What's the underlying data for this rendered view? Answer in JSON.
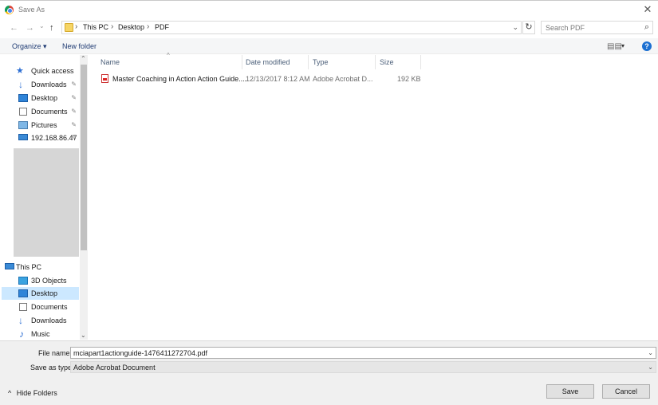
{
  "window": {
    "title": "Save As",
    "close_glyph": "✕"
  },
  "nav": {
    "back_glyph": "←",
    "forward_glyph": "→",
    "recent_glyph": "⌄",
    "up_glyph": "↑"
  },
  "address": {
    "crumbs": [
      "This PC",
      "Desktop",
      "PDF"
    ],
    "separator": "›",
    "dropdown_glyph": "⌄",
    "refresh_glyph": "↻"
  },
  "search": {
    "placeholder": "Search PDF",
    "icon_glyph": "⌕"
  },
  "toolbar": {
    "organize_label": "Organize ▾",
    "new_folder_label": "New folder",
    "view_glyph": "▤▤",
    "view_drop_glyph": "▾",
    "help_glyph": "?"
  },
  "sidebar": {
    "quick_access": [
      {
        "label": "Quick access",
        "icon": "star-icon",
        "pinned": false
      },
      {
        "label": "Downloads",
        "icon": "download-arrow-icon",
        "pinned": true
      },
      {
        "label": "Desktop",
        "icon": "desktop-icon",
        "pinned": true
      },
      {
        "label": "Documents",
        "icon": "documents-icon",
        "pinned": true
      },
      {
        "label": "Pictures",
        "icon": "pictures-icon",
        "pinned": true
      },
      {
        "label": "192.168.86.47",
        "icon": "network-drive-icon",
        "pinned": true
      }
    ],
    "this_pc": [
      {
        "label": "This PC",
        "icon": "computer-icon",
        "selected": false
      },
      {
        "label": "3D Objects",
        "icon": "3d-objects-icon",
        "selected": false
      },
      {
        "label": "Desktop",
        "icon": "desktop-icon",
        "selected": true
      },
      {
        "label": "Documents",
        "icon": "documents-icon",
        "selected": false
      },
      {
        "label": "Downloads",
        "icon": "download-arrow-icon",
        "selected": false
      },
      {
        "label": "Music",
        "icon": "music-icon",
        "selected": false
      }
    ],
    "pin_glyph": "✎",
    "scroll_up_glyph": "⌃",
    "scroll_down_glyph": "⌄"
  },
  "filelist": {
    "columns": [
      "Name",
      "Date modified",
      "Type",
      "Size"
    ],
    "sort_glyph": "^",
    "rows": [
      {
        "name": "Master Coaching in Action Action Guide....",
        "date": "12/13/2017 8:12 AM",
        "type": "Adobe Acrobat D...",
        "size": "192 KB"
      }
    ]
  },
  "save": {
    "filename_label": "File name:",
    "filename_value": "mciapart1actionguide-1476411272704.pdf",
    "type_label": "Save as type:",
    "type_value": "Adobe Acrobat Document",
    "drop_glyph": "⌄",
    "hide_folders_label": "Hide Folders",
    "hide_folders_glyph": "^",
    "save_label": "Save",
    "cancel_label": "Cancel"
  },
  "colors": {
    "selection": "#cce8ff",
    "help": "#1b6fd1",
    "link": "#1e3a72"
  }
}
